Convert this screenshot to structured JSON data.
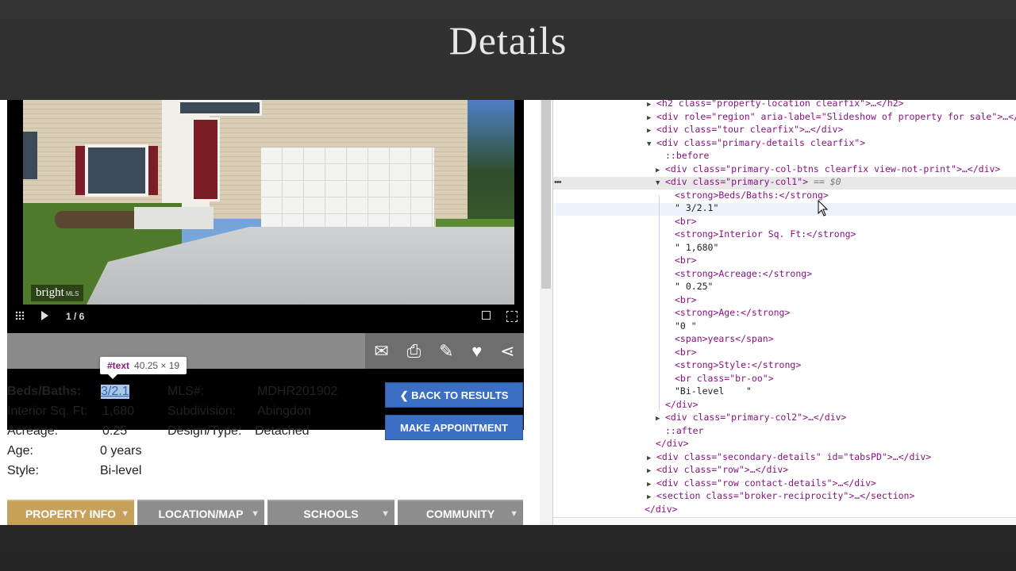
{
  "slide": {
    "title": "Details"
  },
  "photo": {
    "badge_brand": "bright",
    "badge_sub": "MLS",
    "counter": "1 / 6"
  },
  "toolbar": {
    "icons": [
      "email-icon",
      "print-icon",
      "edit-icon",
      "heart-icon",
      "share-icon"
    ]
  },
  "tooltip": {
    "node": "#text",
    "size": "40.25 × 19"
  },
  "details": {
    "left": [
      {
        "label": "Beds/Baths:",
        "value": "3/2.1"
      },
      {
        "label": "Interior Sq. Ft:",
        "value": "1,680"
      },
      {
        "label": "Acreage:",
        "value": "0.25"
      },
      {
        "label": "Age:",
        "value": "0 years"
      },
      {
        "label": "Style:",
        "value": "Bi-level"
      }
    ],
    "right": [
      {
        "label": "MLS#:",
        "value": "MDHR201902"
      },
      {
        "label": "Subdivision:",
        "value": "Abingdon"
      },
      {
        "label": "Design/Type:",
        "value": "Detached"
      }
    ]
  },
  "buttons": {
    "back": "❮ BACK TO RESULTS",
    "appointment": "MAKE APPOINTMENT"
  },
  "tabs": [
    {
      "label": "PROPERTY INFO",
      "active": true
    },
    {
      "label": "LOCATION/MAP",
      "active": false
    },
    {
      "label": "SCHOOLS",
      "active": false
    },
    {
      "label": "COMMUNITY",
      "active": false
    }
  ],
  "devtools": {
    "lines": [
      {
        "text": "<h2 class=\"property-location clearfix\">…</h2>"
      },
      {
        "text": "<div role=\"region\" aria-label=\"Slideshow of property for sale\">…</"
      },
      {
        "text": "<div class=\"tour clearfix\">…</div>"
      },
      {
        "text": "<div class=\"primary-details clearfix\">"
      },
      {
        "text": "::before"
      },
      {
        "text": "<div class=\"primary-col-btns clearfix view-not-print\">…</div>"
      },
      {
        "text": "<div class=\"primary-col1\">",
        "suffix": " == $0"
      },
      {
        "text": "<strong>Beds/Baths:</strong>"
      },
      {
        "text": "\" 3/2.1\""
      },
      {
        "text": "<br>"
      },
      {
        "text": "<strong>Interior Sq. Ft:</strong>"
      },
      {
        "text": "\" 1,680\""
      },
      {
        "text": "<br>"
      },
      {
        "text": "<strong>Acreage:</strong>"
      },
      {
        "text": "\" 0.25\""
      },
      {
        "text": "<br>"
      },
      {
        "text": "<strong>Age:</strong>"
      },
      {
        "text": "\"0 \""
      },
      {
        "text": "<span>years</span>"
      },
      {
        "text": "<br>"
      },
      {
        "text": "<strong>Style:</strong>"
      },
      {
        "text": "<br class=\"br-oo\">"
      },
      {
        "text": "\"Bi-level    \""
      },
      {
        "text": "</div>"
      },
      {
        "text": "<div class=\"primary-col2\">…</div>"
      },
      {
        "text": "::after"
      },
      {
        "text": "</div>"
      },
      {
        "text": "<div class=\"secondary-details\" id=\"tabsPD\">…</div>"
      },
      {
        "text": "<div class=\"row\">…</div>"
      },
      {
        "text": "<div class=\"row contact-details\">…</div>"
      },
      {
        "text": "<section class=\"broker-reciprocity\">…</section>"
      },
      {
        "text": "</div>"
      }
    ]
  },
  "colors": {
    "active_tab": "#c7a15a",
    "button": "#3a6fc4",
    "tag": "#881280",
    "attr_value": "#1a1aa6"
  }
}
